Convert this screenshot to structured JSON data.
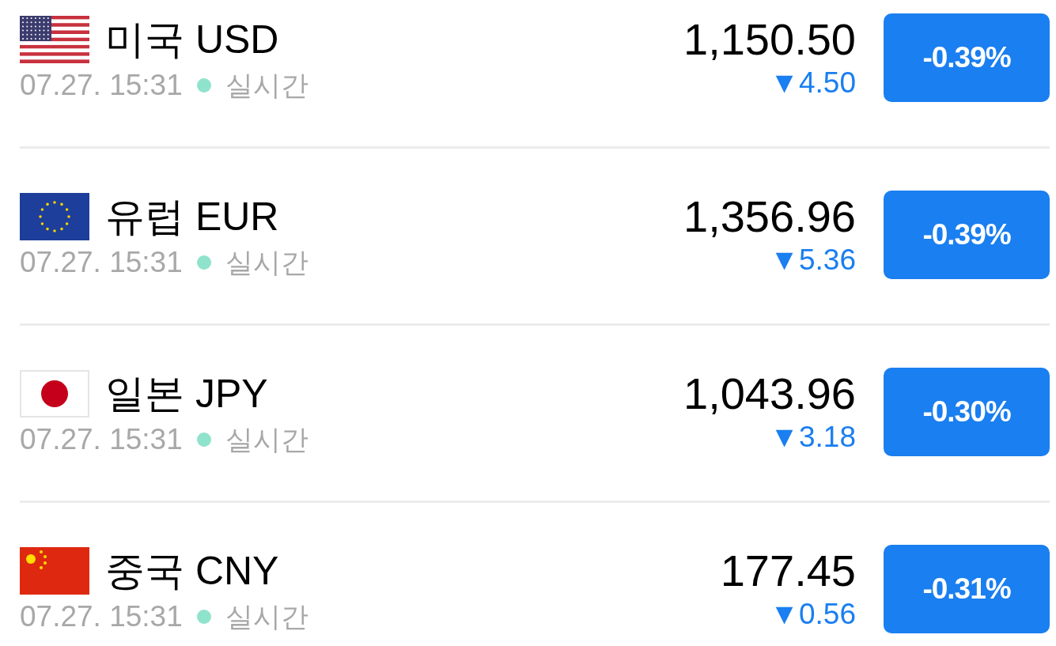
{
  "rates": [
    {
      "kind": "us",
      "name": "미국 USD",
      "time": "07.27. 15:31",
      "status": "실시간",
      "color": "#8fe3cc",
      "price": "1,150.50",
      "change": "▼4.50",
      "falling": true,
      "percent": "-0.39%"
    },
    {
      "kind": "eu",
      "name": "유럽 EUR",
      "time": "07.27. 15:31",
      "status": "실시간",
      "color": "#8fe3cc",
      "price": "1,356.96",
      "change": "▼5.36",
      "falling": true,
      "percent": "-0.39%"
    },
    {
      "kind": "jp",
      "name": "일본 JPY",
      "time": "07.27. 15:31",
      "status": "실시간",
      "color": "#8fe3cc",
      "price": "1,043.96",
      "change": "▼3.18",
      "falling": true,
      "percent": "-0.30%"
    },
    {
      "kind": "cn",
      "name": "중국 CNY",
      "time": "07.27. 15:31",
      "status": "실시간",
      "color": "#8fe3cc",
      "price": "177.45",
      "change": "▼0.56",
      "falling": true,
      "percent": "-0.31%"
    }
  ]
}
